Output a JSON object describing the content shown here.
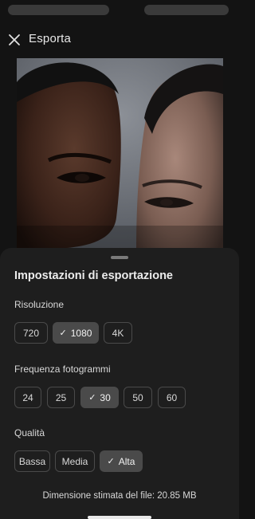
{
  "header": {
    "title": "Esporta",
    "close_icon": "close-icon"
  },
  "preview": {
    "image": "portrait-photo"
  },
  "sheet": {
    "title": "Impostazioni di esportazione",
    "resolution": {
      "label": "Risoluzione",
      "options": [
        "720",
        "1080",
        "4K"
      ],
      "selected": "1080"
    },
    "framerate": {
      "label": "Frequenza fotogrammi",
      "options": [
        "24",
        "25",
        "30",
        "50",
        "60"
      ],
      "selected": "30"
    },
    "quality": {
      "label": "Qualità",
      "options": [
        "Bassa",
        "Media",
        "Alta"
      ],
      "selected": "Alta"
    },
    "file_size": "Dimensione stimata del file: 20.85 MB"
  },
  "colors": {
    "background": "#131313",
    "sheet": "#1e1e1e",
    "chip_selected": "#4a4a4a",
    "chip_border": "#4a4a4a"
  }
}
